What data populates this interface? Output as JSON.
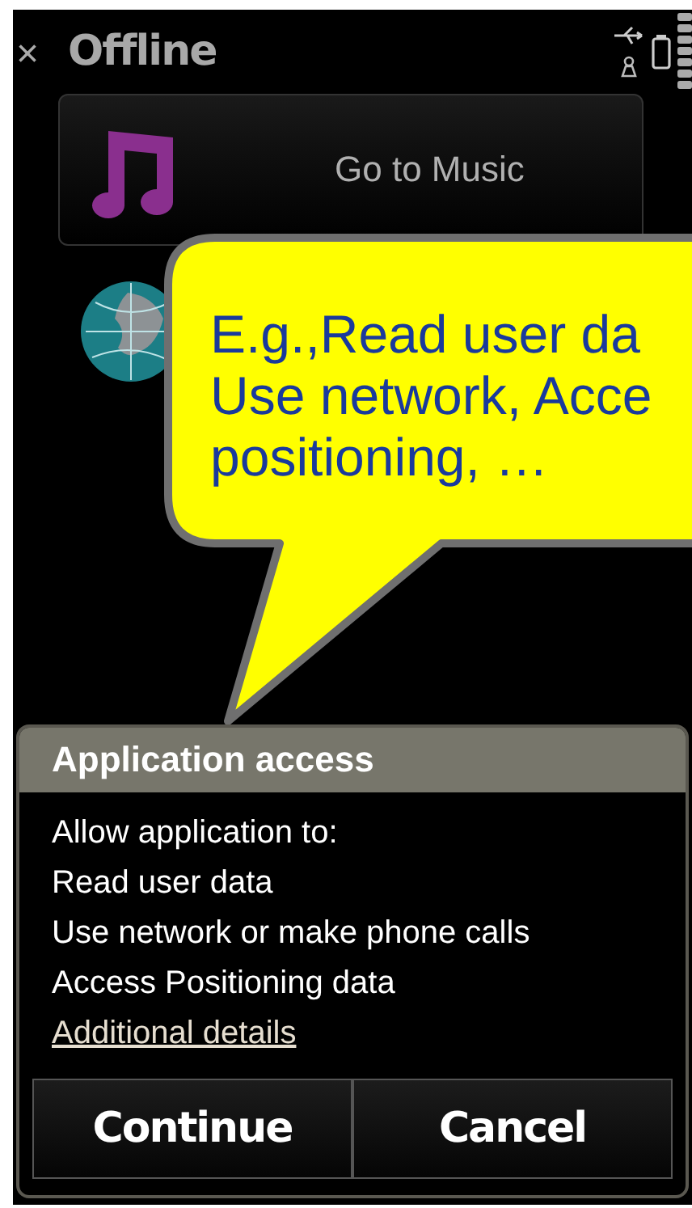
{
  "status_bar": {
    "close": "×",
    "title": "Offline"
  },
  "shortcut": {
    "label": "Go to Music"
  },
  "callout": {
    "lines": [
      "E.g.,Read user da",
      "Use network, Acce",
      "positioning, …"
    ]
  },
  "dialog": {
    "title": "Application access",
    "lines": [
      "Allow application to:",
      "Read user data",
      "Use network or make phone calls",
      "Access Positioning data"
    ],
    "link": "Additional details",
    "buttons": [
      "Continue",
      "Cancel"
    ]
  }
}
